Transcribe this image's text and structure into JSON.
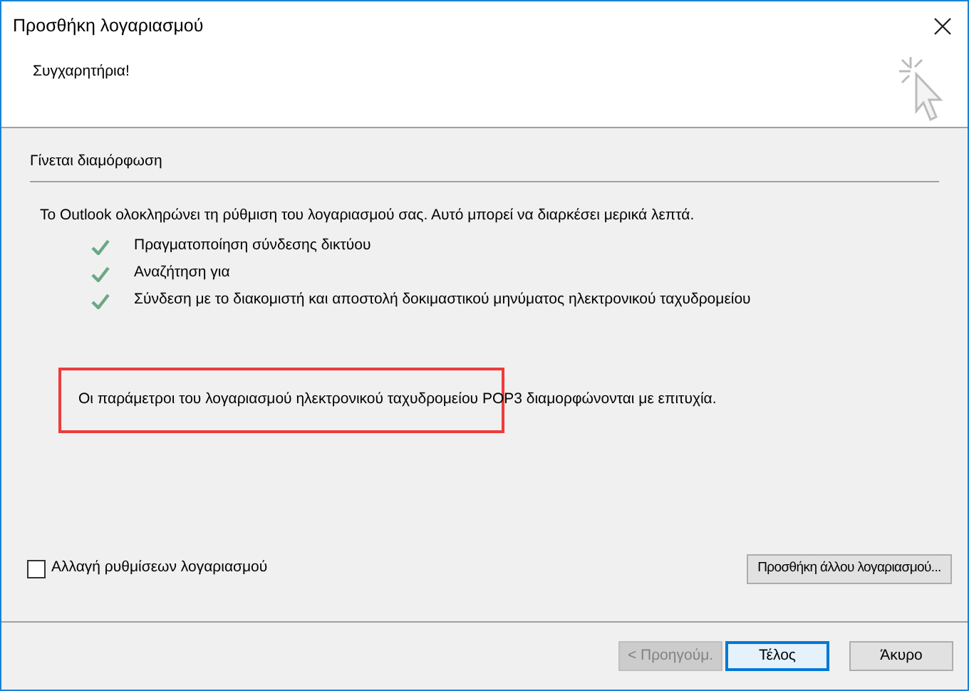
{
  "window": {
    "title": "Προσθήκη λογαριασμού"
  },
  "header": {
    "title": "Συγχαρητήρια!"
  },
  "section": {
    "title": "Γίνεται διαμόρφωση"
  },
  "intro": "Το Outlook ολοκληρώνει τη ρύθμιση του λογαριασμού σας. Αυτό μπορεί να διαρκέσει μερικά λεπτά.",
  "steps": [
    {
      "label": "Πραγματοποίηση σύνδεσης δικτύου",
      "done": true
    },
    {
      "label": "Αναζήτηση για",
      "done": true
    },
    {
      "label": "Σύνδεση με το διακομιστή και αποστολή δοκιμαστικού μηνύματος ηλεκτρονικού ταχυδρομείου",
      "done": true
    }
  ],
  "result": {
    "text": "Οι παράμετροι του λογαριασμού ηλεκτρονικού ταχυδρομείου POP3 διαμορφώνονται με επιτυχία.",
    "highlighted": true
  },
  "change_settings": {
    "label": "Αλλαγή ρυθμίσεων λογαριασμού",
    "checked": false
  },
  "add_another": "Προσθήκη άλλου λογαριασμού...",
  "buttons": [
    {
      "label": "< Προηγούμ.",
      "disabled": true,
      "focused": false
    },
    {
      "label": "Τέλος",
      "disabled": false,
      "focused": true
    },
    {
      "label": "Άκυρο",
      "disabled": false,
      "focused": false
    }
  ]
}
